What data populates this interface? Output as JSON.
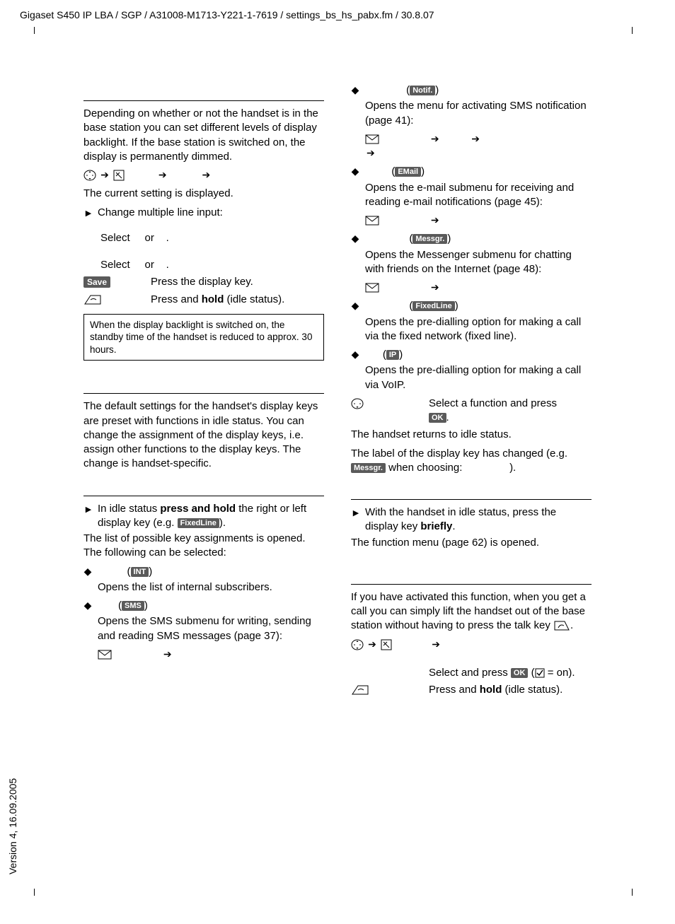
{
  "header": "Gigaset S450 IP LBA / SGP / A31008-M1713-Y221-1-7619 / settings_bs_hs_pabx.fm / 30.8.07",
  "version": "Version 4, 16.09.2005",
  "left": {
    "p1": "Depending on whether or not the handset is in the base station you can set different levels of display backlight. If the base station is switched on, the display is permanently dimmed.",
    "p2": "The current setting is displayed.",
    "p3": "Change multiple line input:",
    "select1a": "Select",
    "select1b": "or",
    "select1c": ".",
    "select2a": "Select",
    "select2b": "or",
    "select2c": ".",
    "save_badge": "Save",
    "save_text": "Press the display key.",
    "hold_text_a": "Press and ",
    "hold_bold": "hold",
    "hold_text_b": " (idle status).",
    "note": "When the display backlight is switched on, the standby time of the handset is reduced to approx. 30 hours.",
    "p4": "The default settings for the handset's display keys are preset with functions in idle status. You can change the assignment of the display keys, i.e. assign other functions to the display keys. The change is handset-specific.",
    "p5a": "In idle status ",
    "p5bold": "press and hold",
    "p5b": " the right or left display key (e.g. ",
    "p5badge": "FixedLine",
    "p5c": ").",
    "p6": "The list of possible key assignments is opened. The following can be selected:",
    "int_badge": "INT",
    "int_text": "Opens the list of internal subscribers.",
    "sms_badge": "SMS",
    "sms_text": "Opens the SMS submenu for writing, sending and reading SMS messages (page 37):"
  },
  "right": {
    "notif_badge": "Notif.",
    "notif_text": "Opens the menu for activating SMS notification (page 41):",
    "email_badge": "EMail",
    "email_text": "Opens the e-mail submenu for receiving and reading e-mail notifications (page 45):",
    "messgr_badge": "Messgr.",
    "messgr_text": "Opens the Messenger submenu for chatting with friends on the Internet (page 48):",
    "fixed_badge": "FixedLine",
    "fixed_text": "Opens the pre-dialling option for making a call via the fixed network (fixed line).",
    "ip_badge": "IP",
    "ip_text": "Opens the pre-dialling option for making a call via VoIP.",
    "select_fn_a": "Select a function and press ",
    "ok_badge": "OK",
    "select_fn_b": ".",
    "p_idle": "The handset returns to idle status.",
    "p_label_a": "The label of the display key has changed (e.g. ",
    "p_label_badge": "Messgr.",
    "p_label_b": " when choosing: ",
    "p_label_c": ").",
    "brief_a": "With the handset in idle status, press the display key ",
    "brief_bold": "briefly",
    "brief_b": ".",
    "fn_menu": "The function menu (page 62) is opened.",
    "auto_p": "If you have activated this function, when you get a call you can simply lift the handset out of the base station without having to press the talk key ",
    "sel_press_a": "Select and press ",
    "sel_press_ok": "OK",
    "sel_press_b": " (",
    "sel_press_c": " = on).",
    "hold2_a": "Press and ",
    "hold2_bold": "hold",
    "hold2_b": " (idle status)."
  }
}
